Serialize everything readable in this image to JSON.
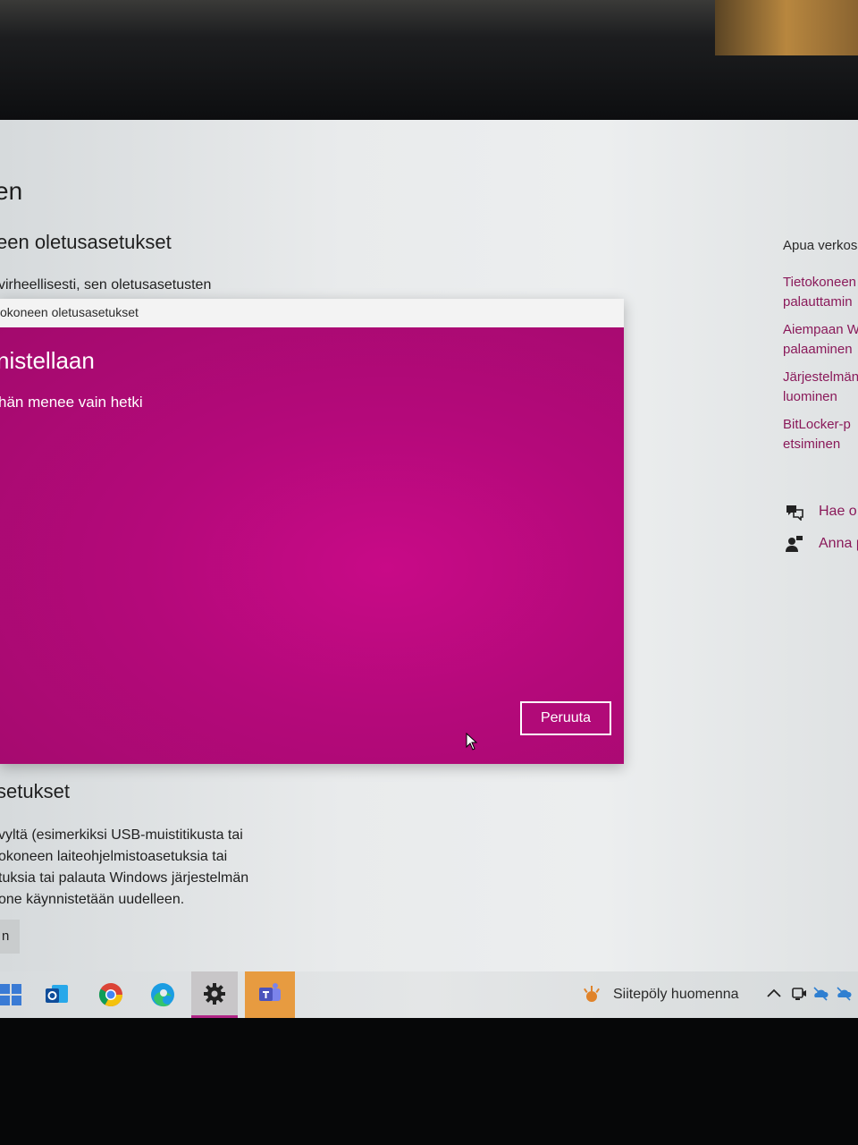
{
  "settings": {
    "page_title_partial": "en",
    "section1_title_partial": "een oletusasetukset",
    "section1_text_partial": "virheellisesti, sen oletusasetusten",
    "section2_title_partial": "setukset",
    "section2_lines_partial": [
      "vyltä (esimerkiksi USB-muistitikusta tai",
      "okoneen laiteohjelmistoasetuksia tai",
      "tuksia tai palauta Windows järjestelmän",
      "one käynnistetään uudelleen."
    ],
    "section2_button_partial": "n"
  },
  "help_panel": {
    "heading": "Apua verkos",
    "links": [
      [
        "Tietokoneen",
        "palauttamin"
      ],
      [
        "Aiempaan W",
        "palaaminen"
      ],
      [
        "Järjestelmän",
        "luominen"
      ],
      [
        "BitLocker-p",
        "etsiminen"
      ]
    ],
    "get_help": "Hae o",
    "give_feedback": "Anna p"
  },
  "dialog": {
    "window_title": "okoneen oletusasetukset",
    "heading": "nistellaan",
    "subtext": "hän menee vain hetki",
    "cancel_label": "Peruuta",
    "accent_color": "#b4097a"
  },
  "taskbar": {
    "apps": [
      "windows-start",
      "outlook",
      "chrome",
      "edge",
      "settings",
      "teams"
    ],
    "active_app": "settings",
    "weather_text": "Siitepöly huomenna"
  }
}
